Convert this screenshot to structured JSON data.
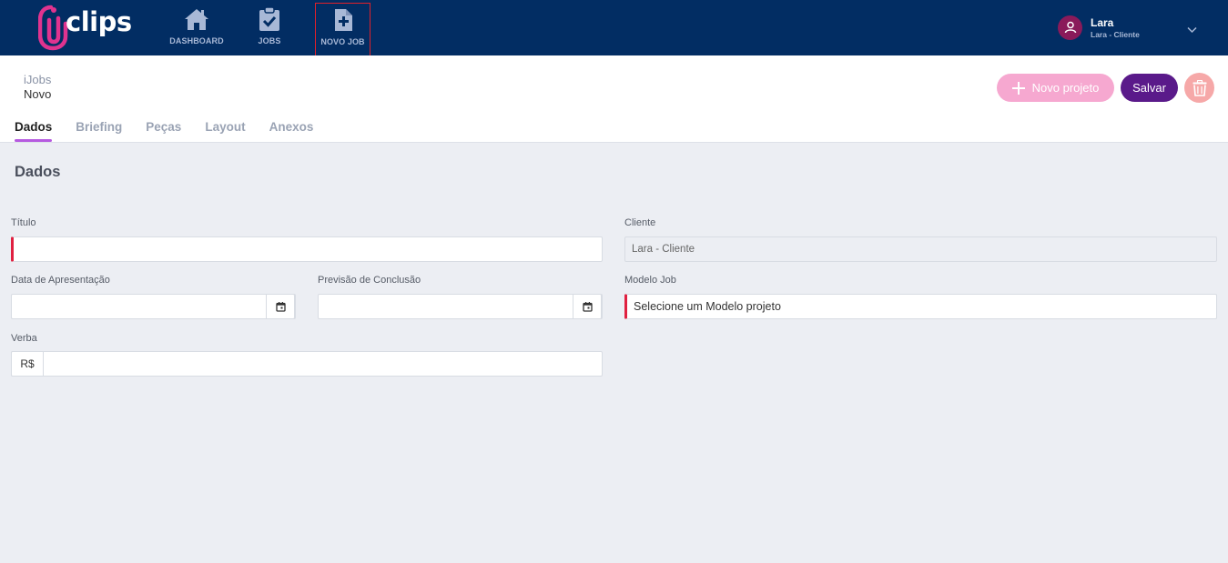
{
  "app": {
    "logo_text": "clips",
    "brand_color": "#e0338f",
    "topbar_color": "#022d63"
  },
  "nav": {
    "dashboard": {
      "label": "DASHBOARD",
      "icon": "home-icon"
    },
    "jobs": {
      "label": "JOBS",
      "icon": "clipboard-check-icon"
    },
    "novo_job": {
      "label": "NOVO JOB",
      "icon": "file-plus-icon"
    }
  },
  "user": {
    "name": "Lara",
    "role": "Lara - Cliente",
    "avatar_icon": "user-icon"
  },
  "breadcrumb": {
    "parent": "iJobs",
    "current": "Novo"
  },
  "actions": {
    "novo_projeto": "Novo projeto",
    "salvar": "Salvar",
    "delete_icon": "trash-icon"
  },
  "tabs": [
    {
      "label": "Dados",
      "active": true
    },
    {
      "label": "Briefing",
      "active": false
    },
    {
      "label": "Peças",
      "active": false
    },
    {
      "label": "Layout",
      "active": false
    },
    {
      "label": "Anexos",
      "active": false
    }
  ],
  "form": {
    "section_title": "Dados",
    "titulo": {
      "label": "Título",
      "value": ""
    },
    "cliente": {
      "label": "Cliente",
      "value": "Lara - Cliente"
    },
    "data_apresentacao": {
      "label": "Data de Apresentação",
      "value": ""
    },
    "previsao_conclusao": {
      "label": "Previsão de Conclusão",
      "value": ""
    },
    "modelo_job": {
      "label": "Modelo Job",
      "value": "Selecione um Modelo projeto"
    },
    "verba": {
      "label": "Verba",
      "prefix": "R$",
      "value": ""
    }
  }
}
